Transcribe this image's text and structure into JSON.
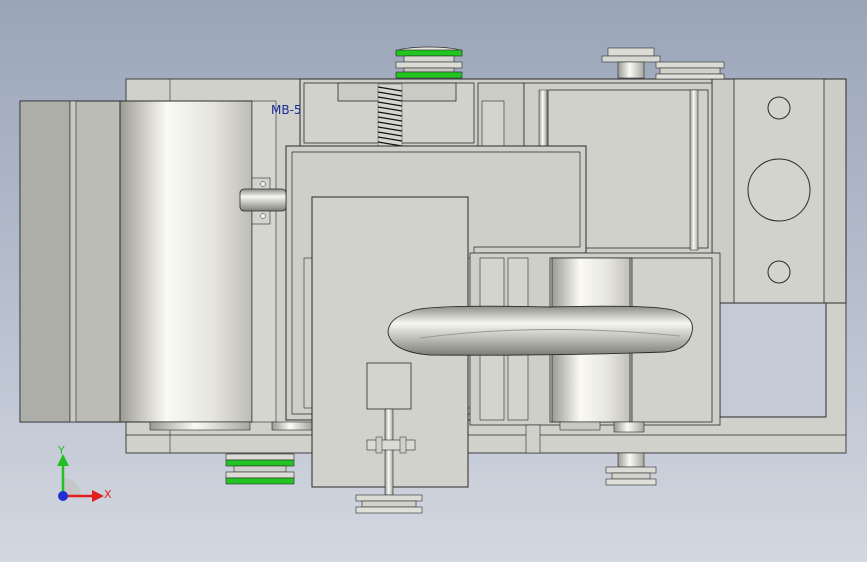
{
  "view": {
    "background_top": "#9aa5b8",
    "background_bottom": "#d3d7e0"
  },
  "annotation": {
    "label": "MB-5",
    "color": "#1a2a9a"
  },
  "triad": {
    "x_label": "X",
    "y_label": "Y",
    "x_color": "#e02020",
    "y_color": "#20c020",
    "z_color": "#2030d0"
  },
  "colors": {
    "plate": "#cfcfc9",
    "plate_dark": "#b9b9b3",
    "edge": "#2a2a2a",
    "seal_green": "#22c422",
    "metal_light": "#f2f2ec",
    "metal_dark": "#8a8a84"
  }
}
